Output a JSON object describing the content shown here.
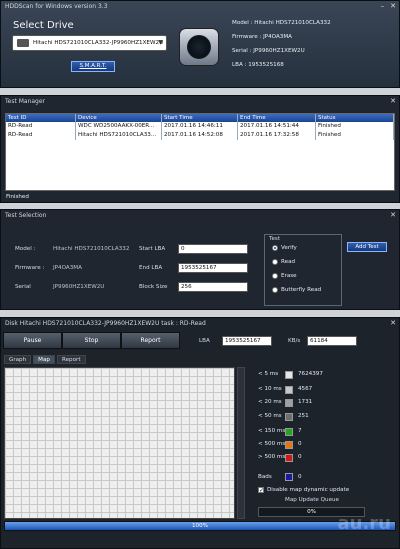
{
  "main": {
    "title": "HDDScan for Windows version 3.3",
    "select_drive": "Select Drive",
    "drive_value": "Hitachi HDS721010CLA332-JP9960HZ1XEW2U",
    "smart": "S.M.A.R.T.",
    "model": "Model : Hitachi HDS721010CLA332",
    "firmware": "Firmware : JP4OA3MA",
    "serial": "Serial : JP9960HZ1XEW2U",
    "lba": "LBA : 1953525168"
  },
  "test_manager": {
    "title": "Test Manager",
    "headers": [
      "Test ID",
      "Device",
      "Start Time",
      "End Time",
      "Status"
    ],
    "rows": [
      [
        "RD-Read",
        "WDC WD2500AAKX-00ER...",
        "2017.01.16 14:46:11",
        "2017.01.16 14:51:44",
        "Finished"
      ],
      [
        "RD-Read",
        "Hitachi HDS721010CLA33...",
        "2017.01.16 14:52:08",
        "2017.01.16 17:32:58",
        "Finished"
      ]
    ],
    "status": "Finished"
  },
  "test_selection": {
    "title": "Test Selection",
    "model_label": "Model :",
    "model_value": "Hitachi HDS721010CLA332",
    "firmware_label": "Firmware :",
    "firmware_value": "JP4OA3MA",
    "serial_label": "Serial",
    "serial_value": "JP9960HZ1XEW2U",
    "start_lba_label": "Start LBA",
    "start_lba": "0",
    "end_lba_label": "End LBA",
    "end_lba": "1953525167",
    "block_size_label": "Block Size",
    "block_size": "256",
    "test_group": "Test",
    "options": [
      "Verify",
      "Read",
      "Erase",
      "Butterfly Read"
    ],
    "selected": "Verify",
    "add_test": "Add Test"
  },
  "scan": {
    "title": "Disk Hitachi HDS721010CLA332-JP9960HZ1XEW2U  task : RD-Read",
    "pause": "Pause",
    "stop": "Stop",
    "report": "Report",
    "lba_label": "LBA",
    "lba_value": "1953525167",
    "kbs_label": "KB/s",
    "kbs_value": "61184",
    "tabs": [
      "Graph",
      "Map",
      "Report"
    ],
    "active_tab": "Map",
    "legend": [
      {
        "label": "< 5 ms",
        "count": "7624397",
        "color": "#e6e6e6"
      },
      {
        "label": "< 10 ms",
        "count": "4567",
        "color": "#c8c8c8"
      },
      {
        "label": "< 20 ms",
        "count": "1731",
        "color": "#a0a0a0"
      },
      {
        "label": "< 50 ms",
        "count": "251",
        "color": "#6e6e6e"
      },
      {
        "label": "< 150 ms",
        "count": "7",
        "color": "#22a622"
      },
      {
        "label": "< 500 ms",
        "count": "0",
        "color": "#e07a10"
      },
      {
        "label": "> 500 ms",
        "count": "0",
        "color": "#d01818"
      },
      {
        "label": "Bads",
        "count": "0",
        "color": "#1a1aa0"
      }
    ],
    "disable_map": "Disable map dynamic update",
    "queue_label": "Map Update Queue",
    "queue_value": "0%",
    "progress": "100%",
    "watermark": "au.ru"
  }
}
